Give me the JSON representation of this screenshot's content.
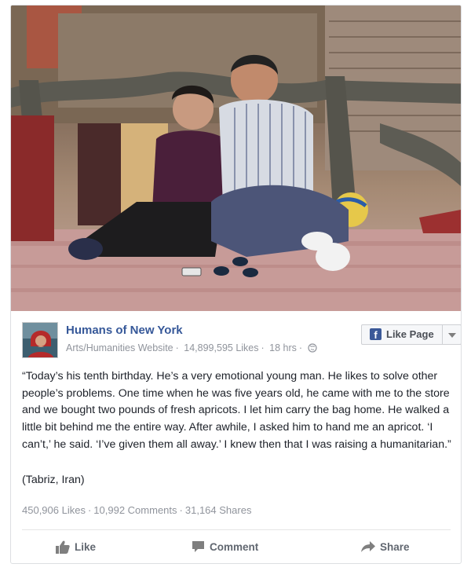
{
  "post": {
    "page_name": "Humans of New York",
    "category": "Arts/Humanities Website",
    "likes_count": "14,899,595 Likes",
    "time": "18 hrs",
    "meta_separator": "·",
    "like_page_label": "Like Page",
    "body": "“Today’s his tenth birthday. He’s a very emotional young man. He likes to solve other people’s problems. One time when he was five years old, he came with me to the store and we bought two pounds of fresh apricots. I let him carry the bag home. He walked a little bit behind me the entire way. After awhile, I asked him to hand me an apricot. ‘I can’t,’ he said. ‘I’ve given them all away.’ I knew then that I was raising a humanitarian.”",
    "location": "(Tabriz, Iran)"
  },
  "stats": {
    "likes": "450,906 Likes",
    "comments": "10,992 Comments",
    "shares": "31,164 Shares",
    "separator": "·"
  },
  "actions": {
    "like": "Like",
    "comment": "Comment",
    "share": "Share"
  },
  "icons": {
    "globe": "globe-icon",
    "facebook": "facebook-logo-icon",
    "thumb": "thumbs-up-icon",
    "comment": "comment-bubble-icon",
    "share": "share-arrow-icon",
    "caret": "chevron-down-icon"
  },
  "colors": {
    "page_name": "#365899",
    "meta": "#90949c",
    "text": "#1d2129",
    "action": "#616770",
    "facebook_blue": "#3b5998"
  }
}
